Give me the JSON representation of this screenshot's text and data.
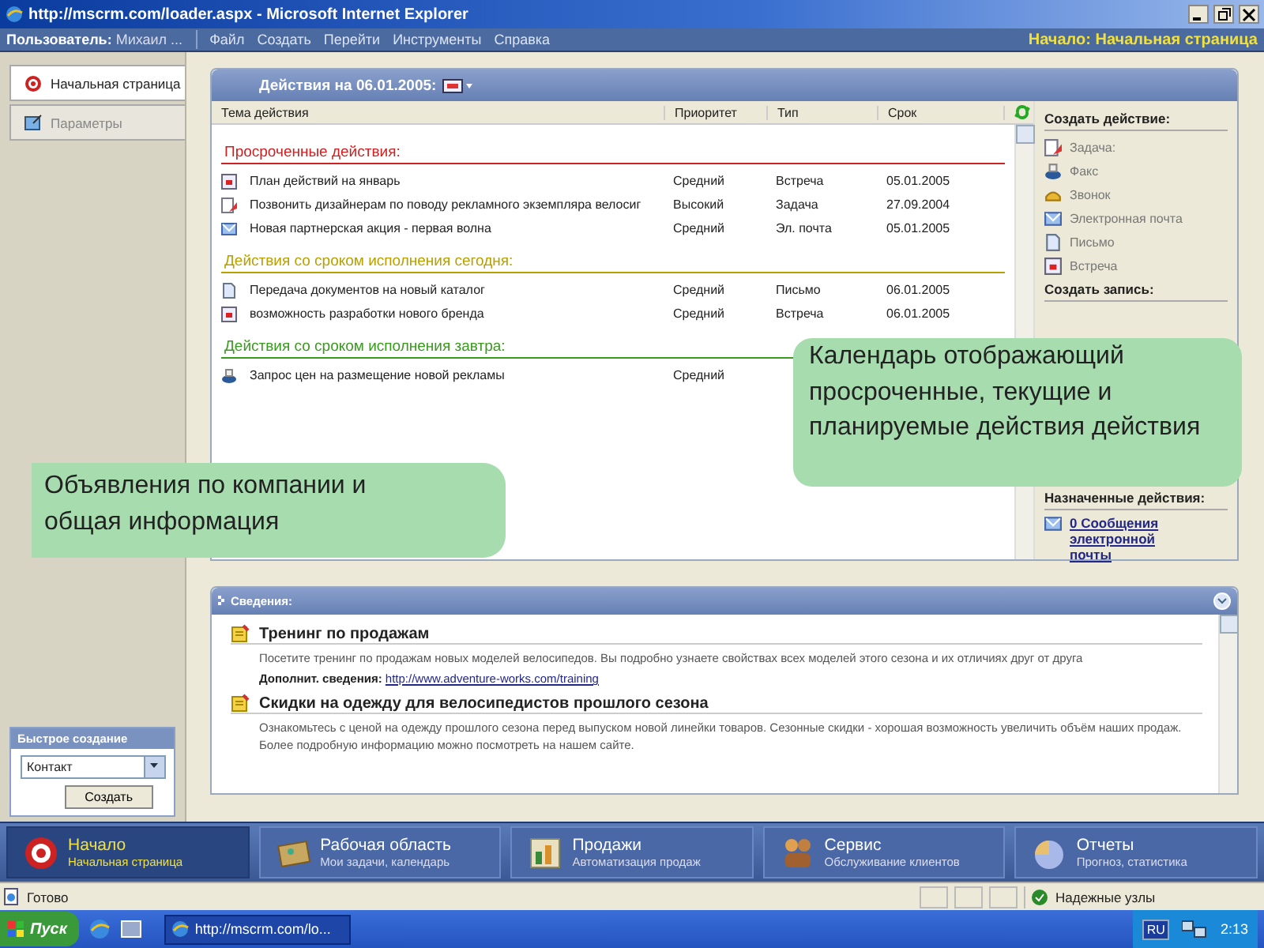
{
  "window": {
    "title": "http://mscrm.com/loader.aspx - Microsoft Internet Explorer"
  },
  "menubar": {
    "user_label": "Пользователь:",
    "user_name": "Михаил ...",
    "items": [
      "Файл",
      "Создать",
      "Перейти",
      "Инструменты",
      "Справка"
    ],
    "location": "Начало: Начальная страница"
  },
  "left_nav": {
    "tabs": [
      {
        "label": "Начальная страница",
        "selected": true,
        "kind": "target"
      },
      {
        "label": "Параметры",
        "selected": false,
        "kind": "settings"
      }
    ],
    "quick_create": {
      "title": "Быстрое создание",
      "value": "Контакт",
      "button": "Создать"
    }
  },
  "actions_panel": {
    "title": "Действия на 06.01.2005:",
    "columns": [
      "Тема действия",
      "Приоритет",
      "Тип",
      "Срок"
    ],
    "groups": [
      {
        "title": "Просроченные действия:",
        "color": "#cc2222",
        "rows": [
          {
            "kind": "appointment",
            "subject": "План действий на январь",
            "priority": "Средний",
            "type": "Встреча",
            "due": "05.01.2005"
          },
          {
            "kind": "task",
            "subject": "Позвонить дизайнерам по поводу рекламного экземпляра велосиг",
            "priority": "Высокий",
            "type": "Задача",
            "due": "27.09.2004"
          },
          {
            "kind": "email",
            "subject": "Новая партнерская акция - первая волна",
            "priority": "Средний",
            "type": "Эл. почта",
            "due": "05.01.2005"
          }
        ]
      },
      {
        "title": "Действия со сроком исполнения сегодня:",
        "color": "#b8a000",
        "rows": [
          {
            "kind": "letter",
            "subject": "Передача документов на новый каталог",
            "priority": "Средний",
            "type": "Письмо",
            "due": "06.01.2005"
          },
          {
            "kind": "appointment",
            "subject": "возможность разработки нового бренда",
            "priority": "Средний",
            "type": "Встреча",
            "due": "06.01.2005"
          }
        ]
      },
      {
        "title": "Действия со сроком исполнения завтра:",
        "color": "#3a9a20",
        "rows": [
          {
            "kind": "fax",
            "subject": "Запрос цен на размещение новой рекламы",
            "priority": "Средний"
          }
        ]
      }
    ]
  },
  "sidebar": {
    "create_action": {
      "title": "Создать действие:",
      "items": [
        {
          "kind": "task",
          "label": "Задача:"
        },
        {
          "kind": "fax",
          "label": "Факс"
        },
        {
          "kind": "phone",
          "label": "Звонок"
        },
        {
          "kind": "email",
          "label": "Электронная почта"
        },
        {
          "kind": "letter",
          "label": "Письмо"
        },
        {
          "kind": "appointment",
          "label": "Встреча"
        }
      ]
    },
    "create_record": {
      "title": "Создать запись:"
    },
    "assigned": {
      "title": "Назначенные действия:",
      "link": "0 Сообщения электронной почты"
    }
  },
  "news": {
    "title": "Сведения:",
    "items": [
      {
        "title": "Тренинг по продажам",
        "text": "Посетите тренинг по продажам новых моделей велосипедов. Вы подробно узнаете свойствах всех моделей этого сезона и их отличиях друг от друга",
        "more_label": "Дополнит. сведения:",
        "more_link": "http://www.adventure-works.com/training"
      },
      {
        "title": "Скидки на одежду для велосипедистов прошлого сезона",
        "text": "Ознакомьтесь с ценой на одежду прошлого сезона перед выпуском новой линейки товаров. Сезонные скидки - хорошая возможность увеличить объём наших продаж. Более подробную информацию можно посмотреть на нашем сайте."
      }
    ]
  },
  "callouts": [
    {
      "text": "Объявления по компании и общая информация"
    },
    {
      "text": "Календарь отображающий просроченные, текущие и планируемые действия действия"
    }
  ],
  "bottom_nav": [
    {
      "kind": "target",
      "title": "Начало",
      "subtitle": "Начальная страница",
      "selected": true
    },
    {
      "kind": "workplace",
      "title": "Рабочая область",
      "subtitle": "Мои задачи, календарь",
      "selected": false
    },
    {
      "kind": "sales",
      "title": "Продажи",
      "subtitle": "Автоматизация продаж",
      "selected": false
    },
    {
      "kind": "service",
      "title": "Сервис",
      "subtitle": "Обслуживание клиентов",
      "selected": false
    },
    {
      "kind": "reports",
      "title": "Отчеты",
      "subtitle": "Прогноз, статистика",
      "selected": false
    }
  ],
  "status_bar": {
    "text": "Готово",
    "zone": "Надежные узлы"
  },
  "taskbar": {
    "start": "Пуск",
    "task": "http://mscrm.com/lo...",
    "lang": "RU",
    "clock": "2:13"
  }
}
